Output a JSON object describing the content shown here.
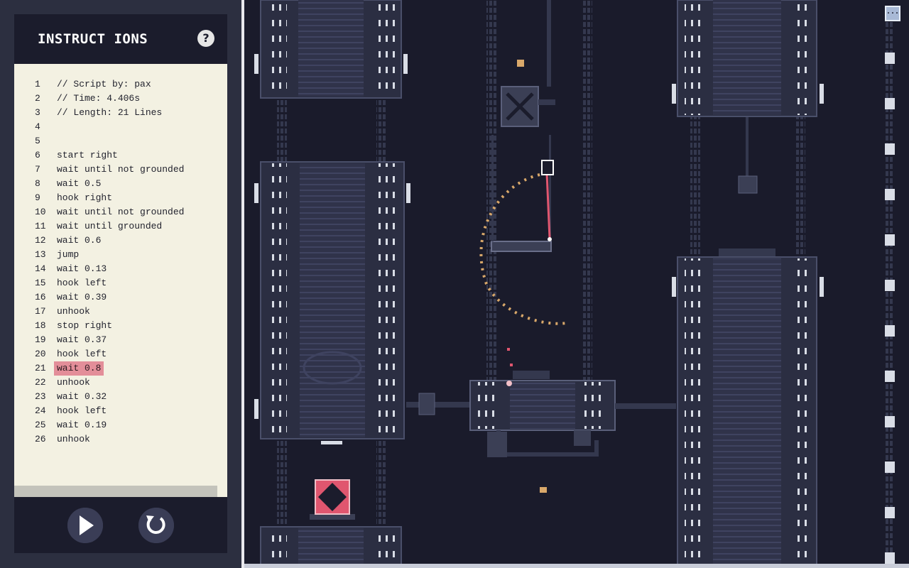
{
  "panel": {
    "title": "INSTRUCT IONS",
    "help_label": "?"
  },
  "script": {
    "active_line": 21,
    "lines": [
      {
        "n": "1",
        "text": "// Script by: pax"
      },
      {
        "n": "2",
        "text": "// Time: 4.406s"
      },
      {
        "n": "3",
        "text": "// Length: 21 Lines"
      },
      {
        "n": "4",
        "text": ""
      },
      {
        "n": "5",
        "text": ""
      },
      {
        "n": "6",
        "text": "start right"
      },
      {
        "n": "7",
        "text": "wait until not grounded"
      },
      {
        "n": "8",
        "text": "wait 0.5"
      },
      {
        "n": "9",
        "text": "hook right"
      },
      {
        "n": "10",
        "text": "wait until not grounded"
      },
      {
        "n": "11",
        "text": "wait until grounded"
      },
      {
        "n": "12",
        "text": "wait 0.6"
      },
      {
        "n": "13",
        "text": "jump"
      },
      {
        "n": "14",
        "text": "wait 0.13"
      },
      {
        "n": "15",
        "text": "hook left"
      },
      {
        "n": "16",
        "text": "wait 0.39"
      },
      {
        "n": "17",
        "text": "unhook"
      },
      {
        "n": "18",
        "text": "stop right"
      },
      {
        "n": "19",
        "text": "wait 0.37"
      },
      {
        "n": "20",
        "text": "hook left"
      },
      {
        "n": "21",
        "text": "wait 0.8"
      },
      {
        "n": "22",
        "text": "unhook"
      },
      {
        "n": "23",
        "text": "wait 0.32"
      },
      {
        "n": "24",
        "text": "hook left"
      },
      {
        "n": "25",
        "text": "wait 0.19"
      },
      {
        "n": "26",
        "text": "unhook"
      }
    ]
  },
  "controls": {
    "play_icon": "play-icon",
    "reset_icon": "reset-icon"
  },
  "game": {
    "corner_button_label": "...",
    "colors": {
      "background": "#1a1b2b",
      "machinery": "#3b3f55",
      "machinery_dark": "#252838",
      "highlight": "#d9dde6",
      "rope": "#e0566f",
      "dust": "#d9a86a",
      "target_pink": "#e0566f"
    }
  },
  "colors": {
    "panel_frame": "#2c2f40",
    "panel_header": "#1b1c2c",
    "editor_bg": "#f3f1e2",
    "active_line_bg": "#e38e99"
  }
}
